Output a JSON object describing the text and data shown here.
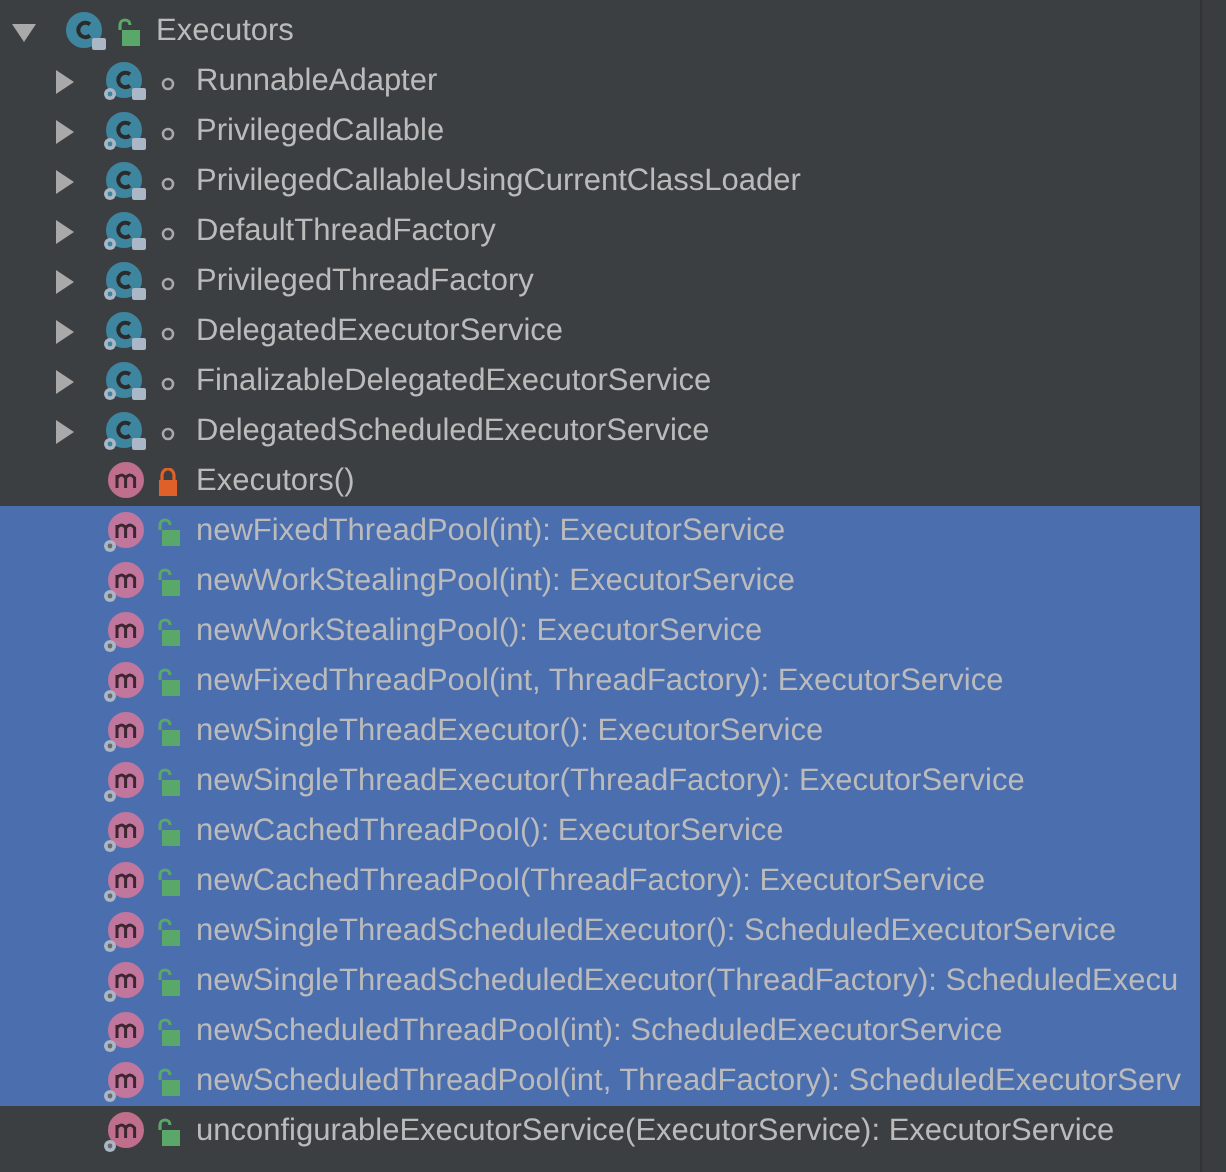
{
  "tree": {
    "name": "Executors",
    "kind": "class",
    "private": false,
    "package_private": false,
    "static": false,
    "expanded": true,
    "selected": false,
    "children": [
      {
        "name": "RunnableAdapter",
        "kind": "class",
        "package_private": true,
        "static": true,
        "expanded": false,
        "selected": false
      },
      {
        "name": "PrivilegedCallable",
        "kind": "class",
        "package_private": true,
        "static": true,
        "expanded": false,
        "selected": false
      },
      {
        "name": "PrivilegedCallableUsingCurrentClassLoader",
        "kind": "class",
        "package_private": true,
        "static": true,
        "expanded": false,
        "selected": false
      },
      {
        "name": "DefaultThreadFactory",
        "kind": "class",
        "package_private": true,
        "static": true,
        "expanded": false,
        "selected": false
      },
      {
        "name": "PrivilegedThreadFactory",
        "kind": "class",
        "package_private": true,
        "static": true,
        "expanded": false,
        "selected": false
      },
      {
        "name": "DelegatedExecutorService",
        "kind": "class",
        "package_private": true,
        "static": true,
        "expanded": false,
        "selected": false
      },
      {
        "name": "FinalizableDelegatedExecutorService",
        "kind": "class",
        "package_private": true,
        "static": true,
        "expanded": false,
        "selected": false
      },
      {
        "name": "DelegatedScheduledExecutorService",
        "kind": "class",
        "package_private": true,
        "static": true,
        "expanded": false,
        "selected": false
      },
      {
        "name": "Executors()",
        "kind": "method",
        "private": true,
        "package_private": false,
        "static": false,
        "selected": false
      },
      {
        "name": "newFixedThreadPool(int): ExecutorService",
        "kind": "method",
        "private": false,
        "package_private": false,
        "static": true,
        "selected": true
      },
      {
        "name": "newWorkStealingPool(int): ExecutorService",
        "kind": "method",
        "private": false,
        "package_private": false,
        "static": true,
        "selected": true
      },
      {
        "name": "newWorkStealingPool(): ExecutorService",
        "kind": "method",
        "private": false,
        "package_private": false,
        "static": true,
        "selected": true
      },
      {
        "name": "newFixedThreadPool(int, ThreadFactory): ExecutorService",
        "kind": "method",
        "private": false,
        "package_private": false,
        "static": true,
        "selected": true
      },
      {
        "name": "newSingleThreadExecutor(): ExecutorService",
        "kind": "method",
        "private": false,
        "package_private": false,
        "static": true,
        "selected": true
      },
      {
        "name": "newSingleThreadExecutor(ThreadFactory): ExecutorService",
        "kind": "method",
        "private": false,
        "package_private": false,
        "static": true,
        "selected": true
      },
      {
        "name": "newCachedThreadPool(): ExecutorService",
        "kind": "method",
        "private": false,
        "package_private": false,
        "static": true,
        "selected": true
      },
      {
        "name": "newCachedThreadPool(ThreadFactory): ExecutorService",
        "kind": "method",
        "private": false,
        "package_private": false,
        "static": true,
        "selected": true
      },
      {
        "name": "newSingleThreadScheduledExecutor(): ScheduledExecutorService",
        "kind": "method",
        "private": false,
        "package_private": false,
        "static": true,
        "selected": true
      },
      {
        "name": "newSingleThreadScheduledExecutor(ThreadFactory): ScheduledExecu",
        "kind": "method",
        "private": false,
        "package_private": false,
        "static": true,
        "selected": true
      },
      {
        "name": "newScheduledThreadPool(int): ScheduledExecutorService",
        "kind": "method",
        "private": false,
        "package_private": false,
        "static": true,
        "selected": true
      },
      {
        "name": "newScheduledThreadPool(int, ThreadFactory): ScheduledExecutorServ",
        "kind": "method",
        "private": false,
        "package_private": false,
        "static": true,
        "selected": true
      },
      {
        "name": "unconfigurableExecutorService(ExecutorService): ExecutorService",
        "kind": "method",
        "private": false,
        "package_private": false,
        "static": true,
        "selected": false
      }
    ]
  }
}
